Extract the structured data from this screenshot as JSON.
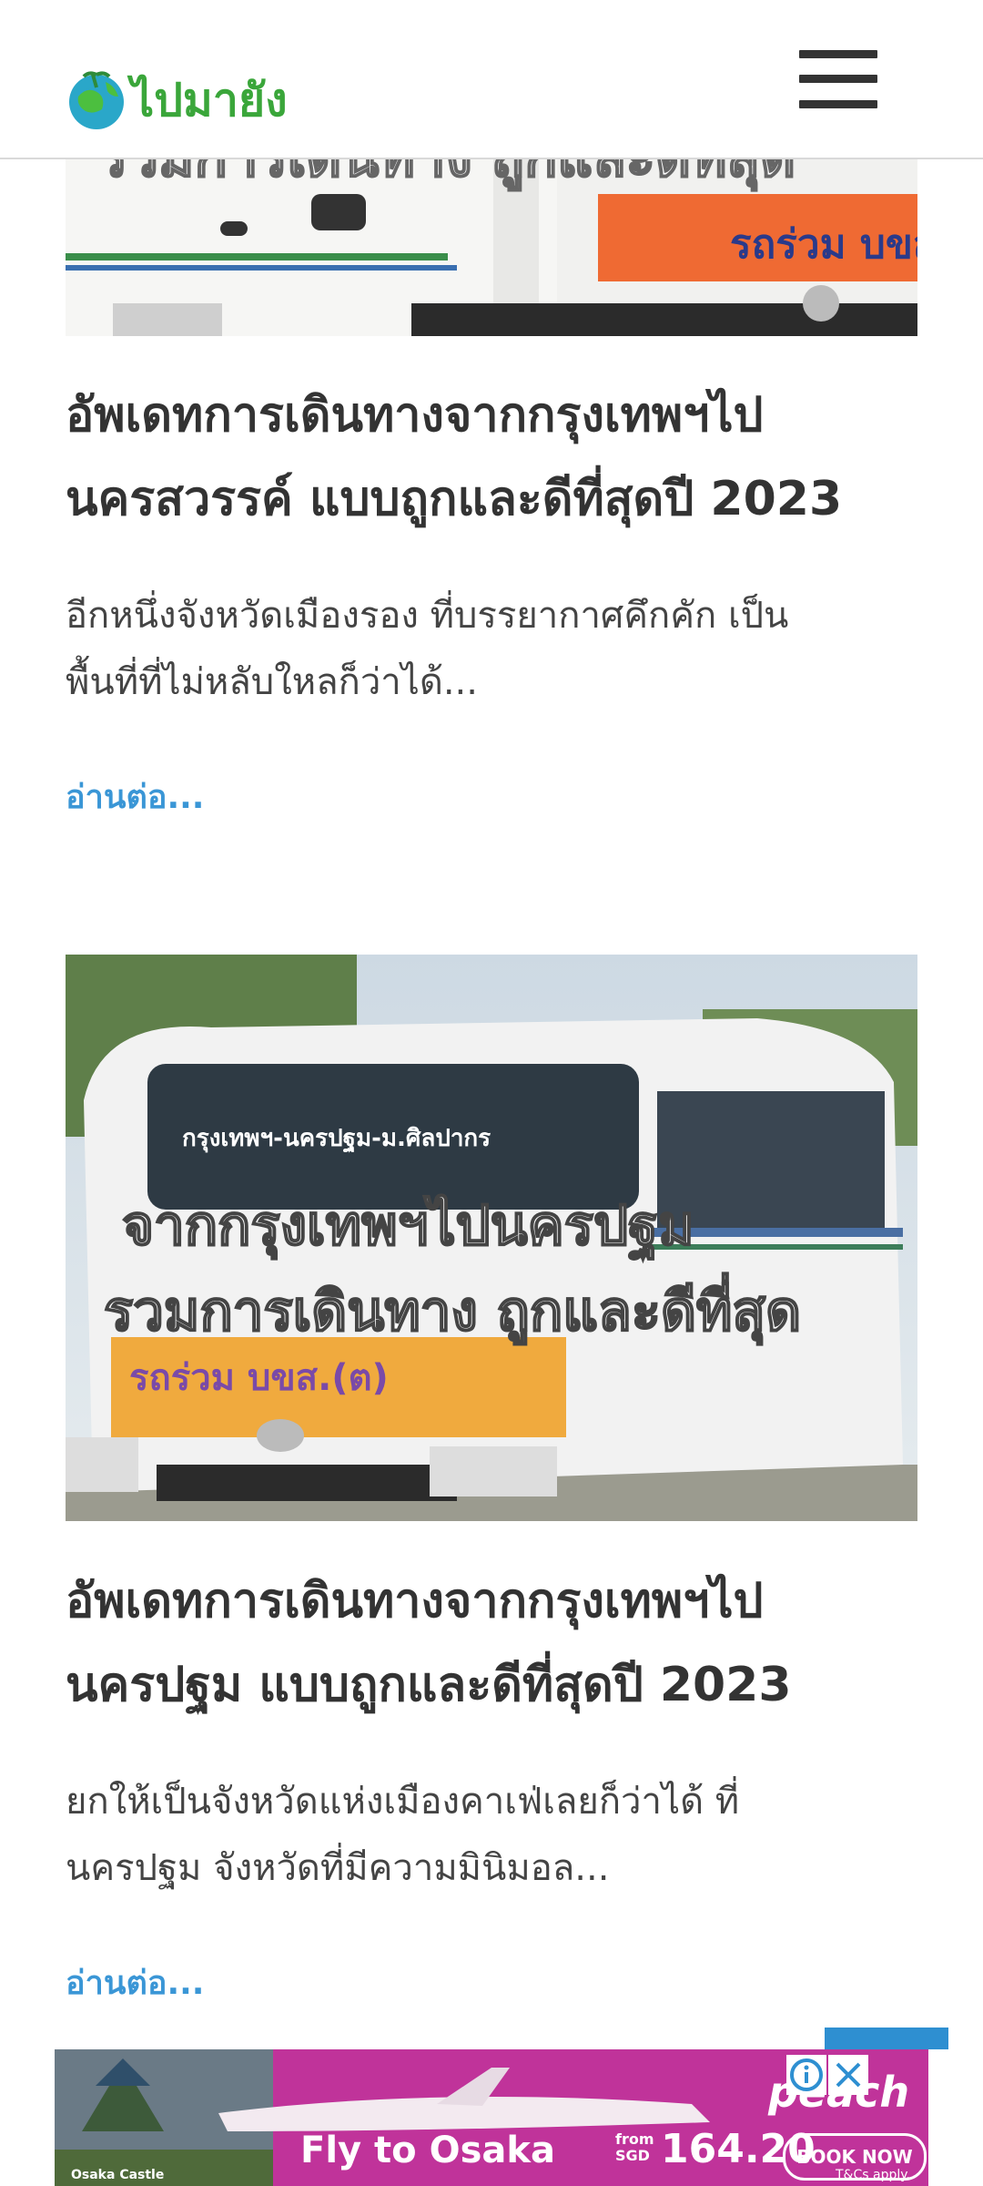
{
  "header": {
    "logo_text": "ไปมายัง",
    "menu_icon": "hamburger-menu-icon"
  },
  "articles": [
    {
      "image_text_line1": "รวมการเดินทาง ถูกและดีที่สุด",
      "image_sign": "รถร่วม  บขส.(",
      "title_line1": "อัพเดทการเดินทางจากกรุงเทพฯไป",
      "title_line2": "นครสวรรค์ แบบถูกและดีที่สุดปี 2023",
      "excerpt_line1": "อีกหนึ่งจังหวัดเมืองรอง ที่บรรยากาศคึกคัก เป็น",
      "excerpt_line2": "พื้นที่ที่ไม่หลับใหลก็ว่าได้...",
      "read_more": "อ่านต่อ..."
    },
    {
      "image_text_line1": "จากกรุงเทพฯไปนครปฐม",
      "image_text_line2": "รวมการเดินทาง ถูกและดีที่สุด",
      "image_route": "กรุงเทพฯ-นครปฐม-ม.ศิลปากร",
      "image_sign": "รถร่วม  บขส.(ต)",
      "title_line1": "อัพเดทการเดินทางจากกรุงเทพฯไป",
      "title_line2": "นครปฐม แบบถูกและดีที่สุดปี 2023",
      "excerpt_line1": "ยกให้เป็นจังหวัดแห่งเมืองคาเฟ่เลยก็ว่าได้ ที่",
      "excerpt_line2": "นครปฐม จังหวัดที่มีความมินิมอล...",
      "read_more": "อ่านต่อ..."
    }
  ],
  "ad": {
    "brand": "peach",
    "headline": "Fly to Osaka",
    "from_label": "from",
    "currency": "SGD",
    "price": "164.20",
    "cta": "BOOK NOW",
    "terms": "T&Cs apply.",
    "caption": "Osaka Castle"
  },
  "colors": {
    "link": "#3a96d6",
    "logo_green": "#3aa63a",
    "ad_pink": "#c0339a"
  }
}
